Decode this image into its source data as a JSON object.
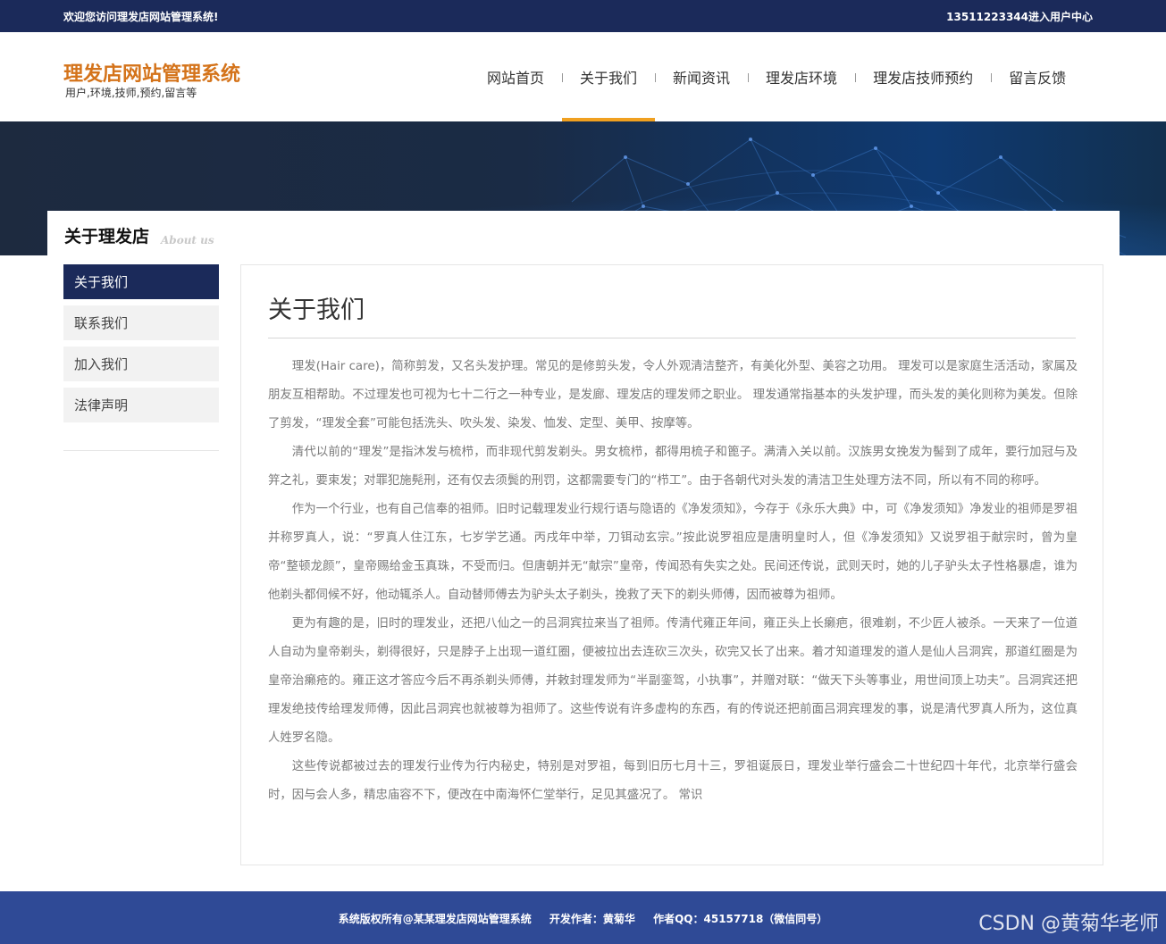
{
  "topbar": {
    "welcome": "欢迎您访问理发店网站管理系统!",
    "user_center": "13511223344进入用户中心"
  },
  "brand": {
    "title": "理发店网站管理系统",
    "subtitle": "用户,环境,技师,预约,留言等",
    "accent": "#d4731a"
  },
  "nav": {
    "items": [
      {
        "label": "网站首页"
      },
      {
        "label": "关于我们"
      },
      {
        "label": "新闻资讯"
      },
      {
        "label": "理发店环境"
      },
      {
        "label": "理发店技师预约"
      },
      {
        "label": "留言反馈"
      }
    ],
    "active_label": "关于我们"
  },
  "section": {
    "title": "关于理发店",
    "title_en": "About us"
  },
  "sidebar": {
    "items": [
      {
        "label": "关于我们"
      },
      {
        "label": "联系我们"
      },
      {
        "label": "加入我们"
      },
      {
        "label": "法律声明"
      }
    ],
    "active_label": "关于我们"
  },
  "content": {
    "heading": "关于我们",
    "paragraphs": [
      "理发(Hair care)，简称剪发，又名头发护理。常见的是修剪头发，令人外观清洁整齐，有美化外型、美容之功用。 理发可以是家庭生活活动，家属及朋友互相帮助。不过理发也可视为七十二行之一种专业，是发廊、理发店的理发师之职业。 理发通常指基本的头发护理，而头发的美化则称为美发。但除了剪发，“理发全套”可能包括洗头、吹头发、染发、恤发、定型、美甲、按摩等。",
      "清代以前的“理发”是指沐发与梳栉，而非现代剪发剃头。男女梳栉，都得用梳子和篦子。满清入关以前。汉族男女挽发为髻到了成年，要行加冠与及笄之礼，要束发；对罪犯施髡刑，还有仅去须鬓的刑罚，这都需要专门的“栉工”。由于各朝代对头发的清洁卫生处理方法不同，所以有不同的称呼。",
      "作为一个行业，也有自己信奉的祖师。旧时记载理发业行规行语与隐语的《净发须知》，今存于《永乐大典》中，可《净发须知》净发业的祖师是罗祖并称罗真人，说：“罗真人住江东，七岁学艺通。丙戌年中举，刀铒动玄宗。”按此说罗祖应是唐明皇时人，但《净发须知》又说罗祖于献宗时，曾为皇帝“整顿龙颜”，皇帝赐给金玉真珠，不受而归。但唐朝并无“献宗”皇帝，传闻恐有失实之处。民间还传说，武则天时，她的儿子驴头太子性格暴虐，谁为他剃头都伺候不好，他动辄杀人。自动替师傅去为驴头太子剃头，挽救了天下的剃头师傅，因而被尊为祖师。",
      "更为有趣的是，旧时的理发业，还把八仙之一的吕洞宾拉来当了祖师。传清代雍正年间，雍正头上长癞疤，很难剃，不少匠人被杀。一天来了一位道人自动为皇帝剃头，剃得很好，只是脖子上出现一道红圈，便被拉出去连砍三次头，砍完又长了出来。着才知道理发的道人是仙人吕洞宾，那道红圈是为皇帝治癞疮的。雍正这才答应今后不再杀剃头师傅，并敕封理发师为“半副銮驾，小执事”，并赠对联：“做天下头等事业，用世间顶上功夫”。吕洞宾还把理发绝技传给理发师傅，因此吕洞宾也就被尊为祖师了。这些传说有许多虚构的东西，有的传说还把前面吕洞宾理发的事，说是清代罗真人所为，这位真人姓罗名隐。",
      "这些传说都被过去的理发行业传为行内秘史，特别是对罗祖，每到旧历七月十三，罗祖诞辰日，理发业举行盛会二十世纪四十年代，北京举行盛会时，因与会人多，精忠庙容不下，便改在中南海怀仁堂举行，足见其盛况了。 常识"
    ]
  },
  "footer": {
    "copyright": "系统版权所有@某某理发店网站管理系统",
    "author": "开发作者：黄菊华",
    "qq": "作者QQ：45157718（微信同号）",
    "watermark": "CSDN @黄菊华老师"
  },
  "colors": {
    "topbar": "#1b2a5a",
    "nav_active_underline": "#f0a020",
    "sidebar_active": "#1b2a5a",
    "footer": "#2f4a96"
  }
}
